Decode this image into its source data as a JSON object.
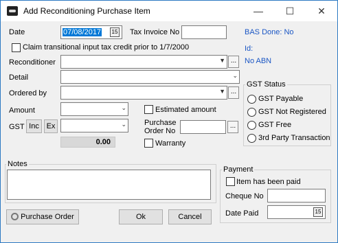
{
  "window": {
    "title": "Add Reconditioning Purchase Item",
    "minimize_icon": "minimize-icon",
    "maximize_icon": "maximize-icon",
    "close_icon": "close-icon"
  },
  "form": {
    "date_label": "Date",
    "date_value": "07/08/2017",
    "tax_invoice_label": "Tax Invoice No",
    "tax_invoice_value": "",
    "bas_done": "BAS Done: No",
    "id_label": "Id:",
    "abn_status": "No ABN",
    "claim_transitional_label": "Claim transitional input tax credit prior to 1/7/2000",
    "reconditioner_label": "Reconditioner",
    "detail_label": "Detail",
    "ordered_by_label": "Ordered by",
    "amount_label": "Amount",
    "estimated_amount_label": "Estimated amount",
    "gst_label": "GST",
    "gst_inc": "Inc",
    "gst_ex": "Ex",
    "purchase_order_label": "Purchase\nOrder No",
    "purchase_order_label_line1": "Purchase",
    "purchase_order_label_line2": "Order No",
    "warranty_label": "Warranty",
    "total_value": "0.00",
    "ellipsis": "..."
  },
  "gst_status": {
    "title": "GST Status",
    "options": [
      "GST Payable",
      "GST Not Registered",
      "GST Free",
      "3rd Party Transaction"
    ]
  },
  "notes": {
    "label": "Notes"
  },
  "payment": {
    "title": "Payment",
    "paid_label": "Item has been paid",
    "cheque_label": "Cheque No",
    "date_paid_label": "Date Paid"
  },
  "buttons": {
    "purchase_order": "Purchase Order",
    "ok": "Ok",
    "cancel": "Cancel"
  },
  "icons": {
    "calendar": "calendar-icon",
    "dropdown": "chevron-down-icon",
    "key": "key-icon"
  }
}
